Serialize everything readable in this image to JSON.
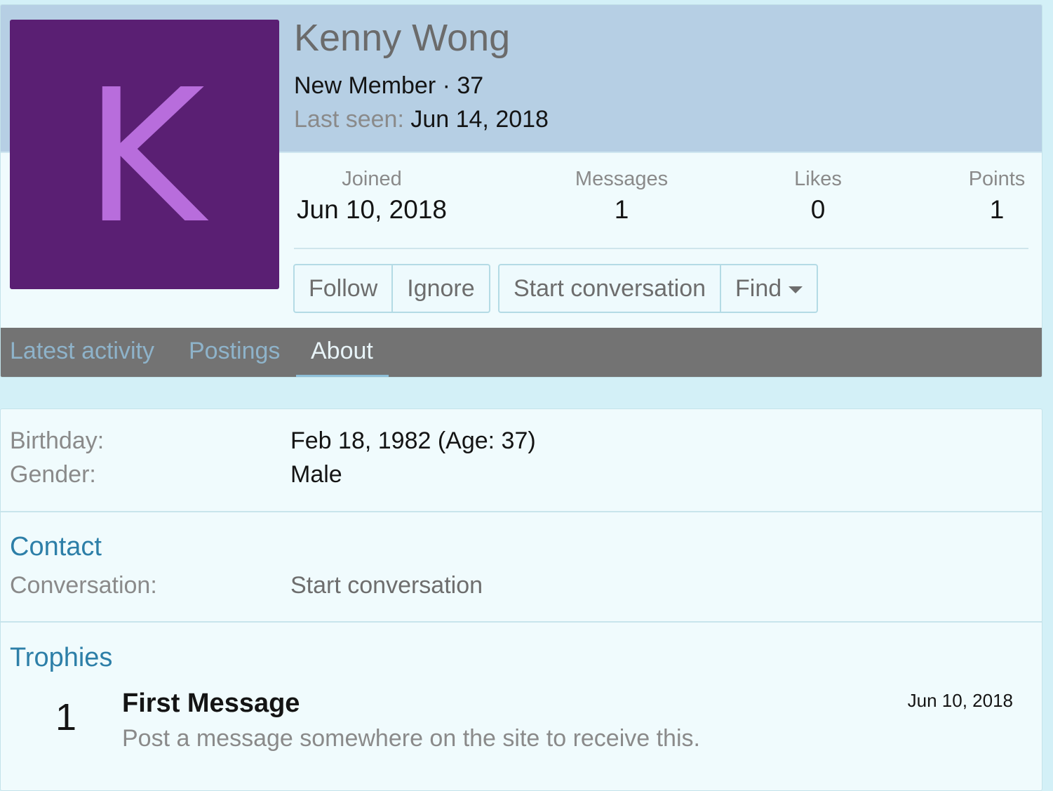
{
  "profile": {
    "avatar_letter": "K",
    "avatar_bg": "#5a1f73",
    "avatar_fg": "#b86ddc",
    "username": "Kenny Wong",
    "user_title": "New Member · 37",
    "last_seen_label": "Last seen:",
    "last_seen_value": "Jun 14, 2018",
    "stats": {
      "joined": {
        "label": "Joined",
        "value": "Jun 10, 2018"
      },
      "messages": {
        "label": "Messages",
        "value": "1"
      },
      "likes": {
        "label": "Likes",
        "value": "0"
      },
      "points": {
        "label": "Points",
        "value": "1"
      }
    },
    "buttons": {
      "follow": "Follow",
      "ignore": "Ignore",
      "start_conversation": "Start conversation",
      "find": "Find"
    },
    "tabs": {
      "latest_activity": "Latest activity",
      "postings": "Postings",
      "about": "About"
    }
  },
  "about": {
    "birthday_label": "Birthday:",
    "birthday_value": "Feb 18, 1982 (Age: 37)",
    "gender_label": "Gender:",
    "gender_value": "Male",
    "contact_title": "Contact",
    "conversation_label": "Conversation:",
    "conversation_link": "Start conversation",
    "trophies_title": "Trophies",
    "trophy": {
      "points": "1",
      "title": "First Message",
      "description": "Post a message somewhere on the site to receive this.",
      "date": "Jun 10, 2018"
    }
  },
  "colors": {
    "banner": "#b6cfe4",
    "tab_bar": "#737373",
    "accent": "#2d7fa8",
    "page_bg": "#d3f0f7"
  }
}
